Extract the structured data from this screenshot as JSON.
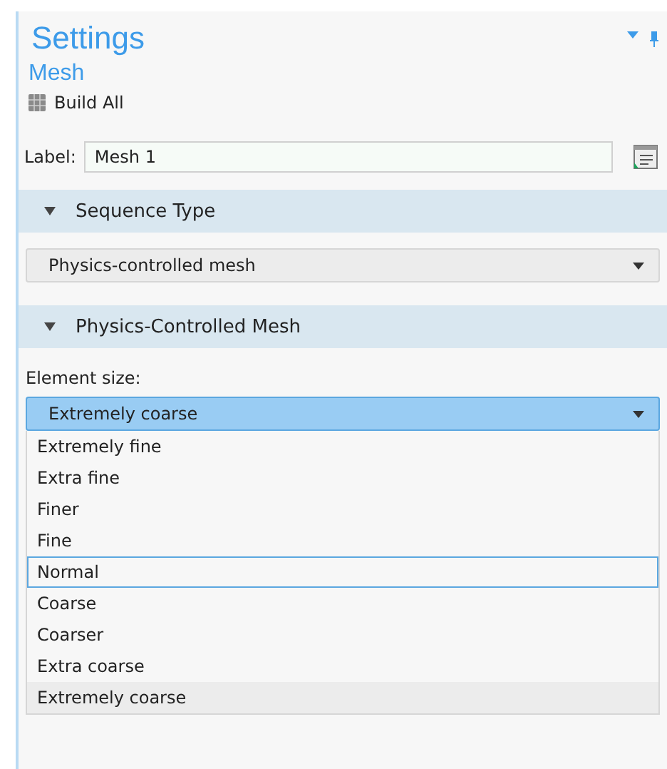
{
  "panel": {
    "title": "Settings",
    "subtitle": "Mesh",
    "build_button": "Build All"
  },
  "label_field": {
    "label": "Label:",
    "value": "Mesh 1"
  },
  "sections": [
    {
      "title": "Sequence Type",
      "expanded": true
    },
    {
      "title": "Physics-Controlled Mesh",
      "expanded": true
    }
  ],
  "sequence_type": {
    "value": "Physics-controlled mesh"
  },
  "element_size": {
    "label": "Element size:",
    "value": "Extremely coarse",
    "open": true,
    "options": [
      {
        "label": "Extremely fine",
        "selected": false,
        "hovered": false
      },
      {
        "label": "Extra fine",
        "selected": false,
        "hovered": false
      },
      {
        "label": "Finer",
        "selected": false,
        "hovered": false
      },
      {
        "label": "Fine",
        "selected": false,
        "hovered": false
      },
      {
        "label": "Normal",
        "selected": false,
        "hovered": true
      },
      {
        "label": "Coarse",
        "selected": false,
        "hovered": false
      },
      {
        "label": "Coarser",
        "selected": false,
        "hovered": false
      },
      {
        "label": "Extra coarse",
        "selected": false,
        "hovered": false
      },
      {
        "label": "Extremely coarse",
        "selected": true,
        "hovered": false
      }
    ]
  }
}
